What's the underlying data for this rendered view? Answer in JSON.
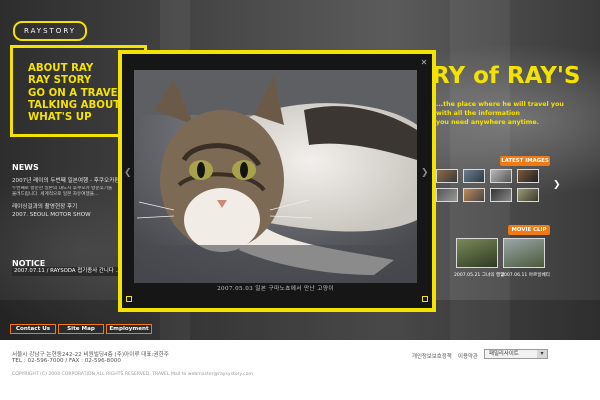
{
  "brand": {
    "logo": "RAYSTORY"
  },
  "tagline": [
    "ABOUT RAY",
    "RAY STORY",
    "GO ON A TRAVEL",
    "TALKING ABOUT",
    "WHAT'S UP"
  ],
  "news": {
    "heading": "NEWS",
    "items": [
      {
        "title": "2007년 레이의 두번째 일본여행 - 후쿠오카편",
        "sub1": "두번째로 방문한 일본의 대도시 후쿠오카 방문후기를",
        "sub2": "올려드립니다. 세계적으로 일본 자유여행을..."
      },
      {
        "title": "레이싱걸과의 촬영현장 후기"
      },
      {
        "title": "2007. SEOUL MOTOR SHOW"
      }
    ]
  },
  "notice": {
    "heading": "NOTICE",
    "text": "2007.07.11 / RAYSODA 접기종사 간니다 .."
  },
  "hero": {
    "title": "RY of RAY'S",
    "desc": [
      "...the place where he will travel you",
      "with all the information",
      "you need anywhere anytime."
    ]
  },
  "latest_images": {
    "label": "LATEST IMAGES"
  },
  "movie_clip": {
    "label": "MOVIE CLIP",
    "captions": [
      "2007.05.21 그녀의 행일",
      "2007.06.11 아르일베티"
    ]
  },
  "bottom_nav": [
    "Contact Us",
    "Site Map",
    "Employment"
  ],
  "popup": {
    "caption": "2007.05.03 일본 구마노쵸에서 만난 고양이"
  },
  "footer": {
    "address": "서울시 강남구 논현동242-22 비원빌딩4층 (주)아이루 대표:권한주",
    "phone": "TEL : 02-596-7000 / FAX : 02-596-8000",
    "copyright": "COPYRIGHT (C) 2004 CORPORATION ALL RIGHTS RESERVED. TRAVEL  Mail to webmaster@raysystory.com",
    "links": [
      "개인정보보호정책",
      "이용약관"
    ],
    "select_value": "패밀리사이트"
  },
  "colors": {
    "accent": "#f4e200",
    "orange": "#f07a14"
  }
}
